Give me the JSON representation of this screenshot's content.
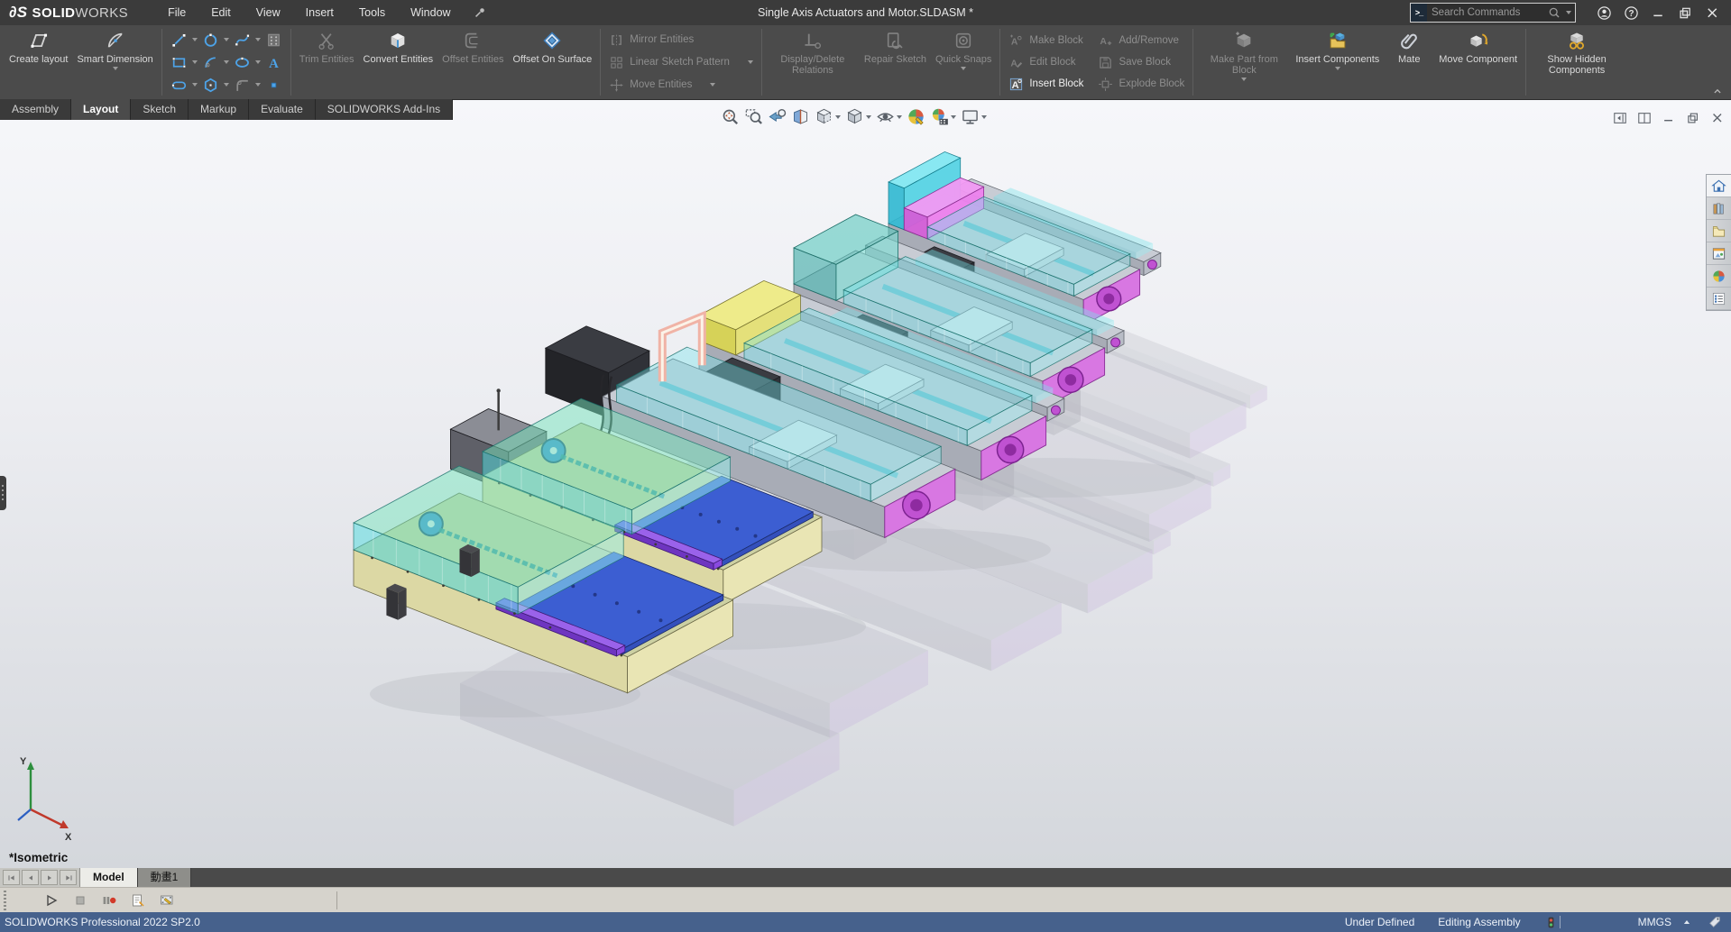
{
  "colors": {
    "titlebar_bg": "#3b3b3b",
    "ribbon_bg": "#4b4b4b",
    "tabstrip_bg": "#303030",
    "statusbar_bg": "#46618c",
    "sketch_blue": "#4da3e8",
    "viewport_top": "#f6f7fa",
    "viewport_bottom": "#d4d7dc"
  },
  "titlebar": {
    "logo_glyph": "∂S",
    "app_name_bold": "SOLID",
    "app_name_light": "WORKS",
    "menus": [
      "File",
      "Edit",
      "View",
      "Insert",
      "Tools",
      "Window"
    ],
    "document_title": "Single Axis Actuators and Motor.SLDASM *",
    "search": {
      "placeholder": "Search Commands",
      "tile_glyph": ">_"
    },
    "window_controls": [
      "user-account",
      "help",
      "win-minimize",
      "win-restore",
      "win-close"
    ]
  },
  "ribbon": {
    "groups": [
      {
        "type": "large",
        "items": [
          {
            "label": "Create layout",
            "icon": "create-layout",
            "enabled": true
          },
          {
            "label": "Smart Dimension",
            "icon": "smart-dimension",
            "enabled": true,
            "dropdown": true
          }
        ]
      },
      {
        "type": "grid",
        "rows": [
          [
            {
              "icon": "line",
              "dropdown": true
            },
            {
              "icon": "circle",
              "dropdown": true
            },
            {
              "icon": "spline",
              "dropdown": true
            },
            {
              "icon": "sketch-pattern"
            }
          ],
          [
            {
              "icon": "rectangle",
              "dropdown": true
            },
            {
              "icon": "arc",
              "dropdown": true
            },
            {
              "icon": "ellipse",
              "dropdown": true
            },
            {
              "icon": "sketch-text"
            }
          ],
          [
            {
              "icon": "slot",
              "dropdown": true
            },
            {
              "icon": "polygon",
              "dropdown": true
            },
            {
              "icon": "fillet",
              "enabled": false,
              "dropdown": true
            },
            {
              "icon": "point"
            }
          ]
        ]
      },
      {
        "type": "large",
        "items": [
          {
            "label": "Trim Entities",
            "icon": "trim-entities",
            "enabled": false
          },
          {
            "label": "Convert Entities",
            "icon": "convert-entities",
            "enabled": true
          },
          {
            "label": "Offset Entities",
            "icon": "offset-entities",
            "enabled": false
          },
          {
            "label": "Offset On Surface",
            "icon": "offset-on-surface",
            "enabled": true
          }
        ]
      },
      {
        "type": "stack",
        "items": [
          {
            "label": "Mirror Entities",
            "icon": "mirror-entities",
            "enabled": false
          },
          {
            "label": "Linear Sketch Pattern",
            "icon": "linear-sketch-pattern",
            "enabled": false,
            "dropdown": true
          },
          {
            "label": "Move Entities",
            "icon": "move-entities",
            "enabled": false,
            "dropdown": true
          }
        ]
      },
      {
        "type": "large",
        "items": [
          {
            "label": "Display/Delete Relations",
            "icon": "display-delete-relations",
            "enabled": false
          },
          {
            "label": "Repair Sketch",
            "icon": "repair-sketch",
            "enabled": false
          },
          {
            "label": "Quick Snaps",
            "icon": "quick-snaps",
            "enabled": false,
            "dropdown": true
          }
        ]
      },
      {
        "type": "blocks",
        "items": [
          {
            "label": "Make Block",
            "icon": "make-block",
            "enabled": false
          },
          {
            "label": "Add/Remove",
            "icon": "add-remove",
            "enabled": false
          },
          {
            "label": "Edit Block",
            "icon": "edit-block",
            "enabled": false
          },
          {
            "label": "Save Block",
            "icon": "save-block",
            "enabled": false
          },
          {
            "label": "Insert Block",
            "icon": "insert-block",
            "enabled": true
          },
          {
            "label": "Explode Block",
            "icon": "explode-block",
            "enabled": false
          }
        ]
      },
      {
        "type": "large",
        "items": [
          {
            "label": "Make Part from Block",
            "icon": "make-part-from-block",
            "enabled": false,
            "dropdown": true
          },
          {
            "label": "Insert Components",
            "icon": "insert-components",
            "enabled": true,
            "dropdown": true
          },
          {
            "label": "Mate",
            "icon": "mate",
            "enabled": true
          },
          {
            "label": "Move Component",
            "icon": "move-component",
            "enabled": true
          }
        ]
      },
      {
        "type": "large",
        "items": [
          {
            "label": "Show Hidden Components",
            "icon": "show-hidden-components",
            "enabled": true
          }
        ]
      }
    ]
  },
  "command_tabs": [
    {
      "label": "Assembly"
    },
    {
      "label": "Layout",
      "active": true
    },
    {
      "label": "Sketch"
    },
    {
      "label": "Markup"
    },
    {
      "label": "Evaluate"
    },
    {
      "label": "SOLIDWORKS Add-Ins"
    }
  ],
  "viewport": {
    "view_label": "*Isometric",
    "triad": {
      "x_label": "X",
      "y_label": "Y"
    },
    "headsup": [
      {
        "icon": "zoom-to-fit"
      },
      {
        "icon": "zoom-to-area"
      },
      {
        "icon": "previous-view"
      },
      {
        "icon": "section-view"
      },
      {
        "icon": "view-orientation",
        "dropdown": true
      },
      {
        "icon": "display-style",
        "dropdown": true
      },
      {
        "icon": "hide-show-items",
        "dropdown": true
      },
      {
        "icon": "edit-appearance"
      },
      {
        "icon": "apply-scene",
        "dropdown": true
      },
      {
        "icon": "view-settings",
        "dropdown": true
      }
    ],
    "doc_window_controls": [
      "pane-left",
      "pane-split",
      "win-minimize",
      "win-restore",
      "win-close"
    ]
  },
  "task_pane": [
    "home",
    "design-library",
    "file-explorer",
    "view-palette",
    "appearances",
    "custom-properties"
  ],
  "model": {
    "units": [
      "actuator-unit-1",
      "actuator-unit-2",
      "actuator-unit-3",
      "actuator-unit-4",
      "actuator-unit-5",
      "actuator-unit-6"
    ]
  },
  "motion": {
    "nav": [
      "nav-first",
      "nav-prev",
      "nav-next",
      "nav-last"
    ],
    "tabs": [
      {
        "label": "Model",
        "active": true
      },
      {
        "label": "動畫1",
        "active": false
      }
    ],
    "toolbar": [
      "m-play",
      "m-stop",
      "m-record",
      "m-wizard",
      "m-edit"
    ]
  },
  "statusbar": {
    "left_text": "SOLIDWORKS Professional 2022 SP2.0",
    "right_items": [
      "Under Defined",
      "Editing Assembly"
    ],
    "unit_system": "MMGS"
  }
}
